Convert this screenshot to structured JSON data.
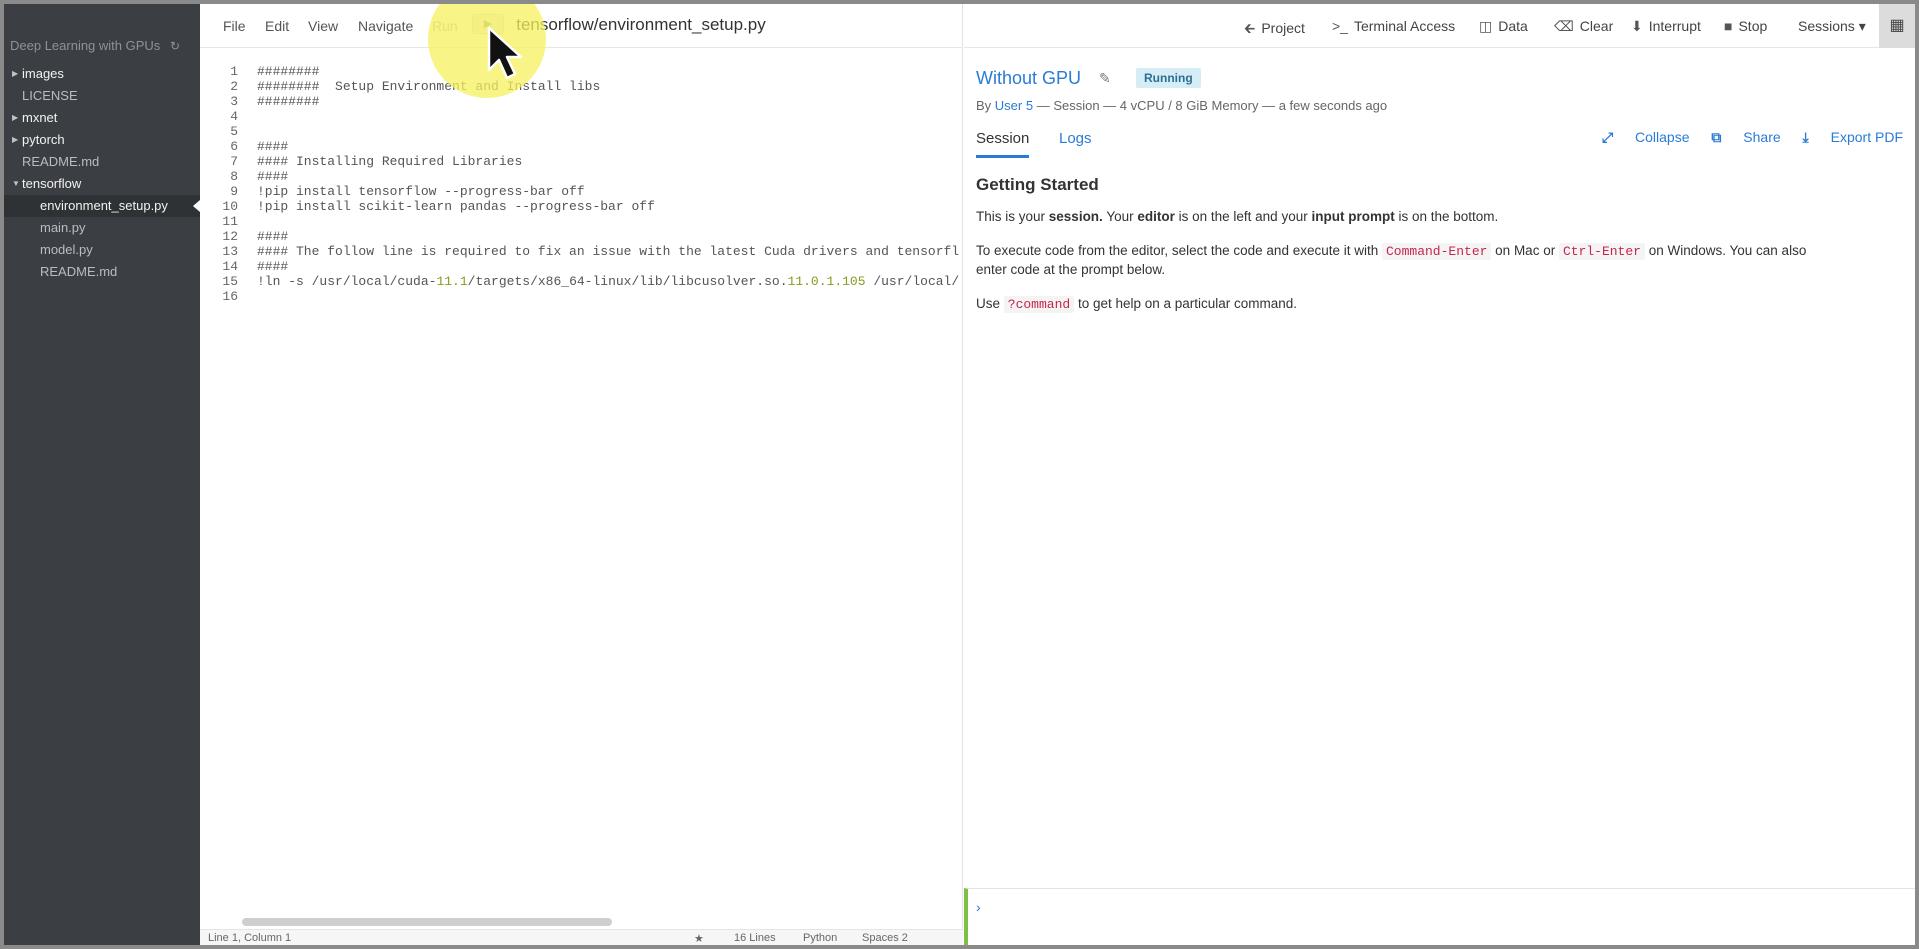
{
  "sidebar": {
    "project_title": "Deep Learning with GPUs",
    "refresh_icon": "refresh-icon",
    "items": [
      {
        "label": "images",
        "type": "folder",
        "depth": 0,
        "expanded": false
      },
      {
        "label": "LICENSE",
        "type": "file",
        "depth": 0
      },
      {
        "label": "mxnet",
        "type": "folder",
        "depth": 0,
        "expanded": false
      },
      {
        "label": "pytorch",
        "type": "folder",
        "depth": 0,
        "expanded": false
      },
      {
        "label": "README.md",
        "type": "file",
        "depth": 0
      },
      {
        "label": "tensorflow",
        "type": "folder",
        "depth": 0,
        "expanded": true
      },
      {
        "label": "environment_setup.py",
        "type": "file",
        "depth": 1,
        "selected": true
      },
      {
        "label": "main.py",
        "type": "file",
        "depth": 1
      },
      {
        "label": "model.py",
        "type": "file",
        "depth": 1
      },
      {
        "label": "README.md",
        "type": "file",
        "depth": 1
      }
    ]
  },
  "editor": {
    "menu": [
      "File",
      "Edit",
      "View",
      "Navigate",
      "Run"
    ],
    "run_icon": "play-icon",
    "file_title": "tensorflow/environment_setup.py",
    "lines": [
      "########",
      "########  Setup Environment and Install libs",
      "########",
      "",
      "",
      "####",
      "#### Installing Required Libraries",
      "####",
      "!pip install tensorflow --progress-bar off",
      "!pip install scikit-learn pandas --progress-bar off",
      "",
      "####",
      "#### The follow line is required to fix an issue with the latest Cuda drivers and tensorfl",
      "####",
      "!ln -s /usr/local/cuda-11.1/targets/x86_64-linux/lib/libcusolver.so.11.0.1.105 /usr/local/",
      ""
    ],
    "status": {
      "position": "Line 1, Column 1",
      "star_icon": "star-icon",
      "line_count": "16 Lines",
      "language": "Python",
      "indent": "Spaces  2"
    }
  },
  "topbar": {
    "project": "Project",
    "terminal": "Terminal Access",
    "data": "Data",
    "clear": "Clear",
    "interrupt": "Interrupt",
    "stop": "Stop",
    "sessions": "Sessions ▾"
  },
  "session": {
    "title": "Without GPU",
    "status": "Running",
    "meta_by": "By ",
    "meta_user": "User 5",
    "meta_rest": " — Session — 4 vCPU / 8 GiB Memory — a few seconds ago",
    "tabs": [
      "Session",
      "Logs"
    ],
    "actions": {
      "collapse": "Collapse",
      "share": "Share",
      "export": "Export PDF"
    }
  },
  "content": {
    "heading": "Getting Started",
    "p1": {
      "a": "This is your ",
      "b": "session.",
      "c": " Your ",
      "d": "editor",
      "e": " is on the left and your ",
      "f": "input prompt",
      "g": " is on the bottom."
    },
    "p2": {
      "a": "To execute code from the editor, select the code and execute it with ",
      "k1": "Command-Enter",
      "b": " on Mac or ",
      "k2": "Ctrl-Enter",
      "c": " on Windows. You can also enter code at the prompt below."
    },
    "p3": {
      "a": "Use ",
      "k": "?command",
      "b": " to get help on a particular command."
    }
  },
  "prompt": {
    "chevron": "›"
  }
}
